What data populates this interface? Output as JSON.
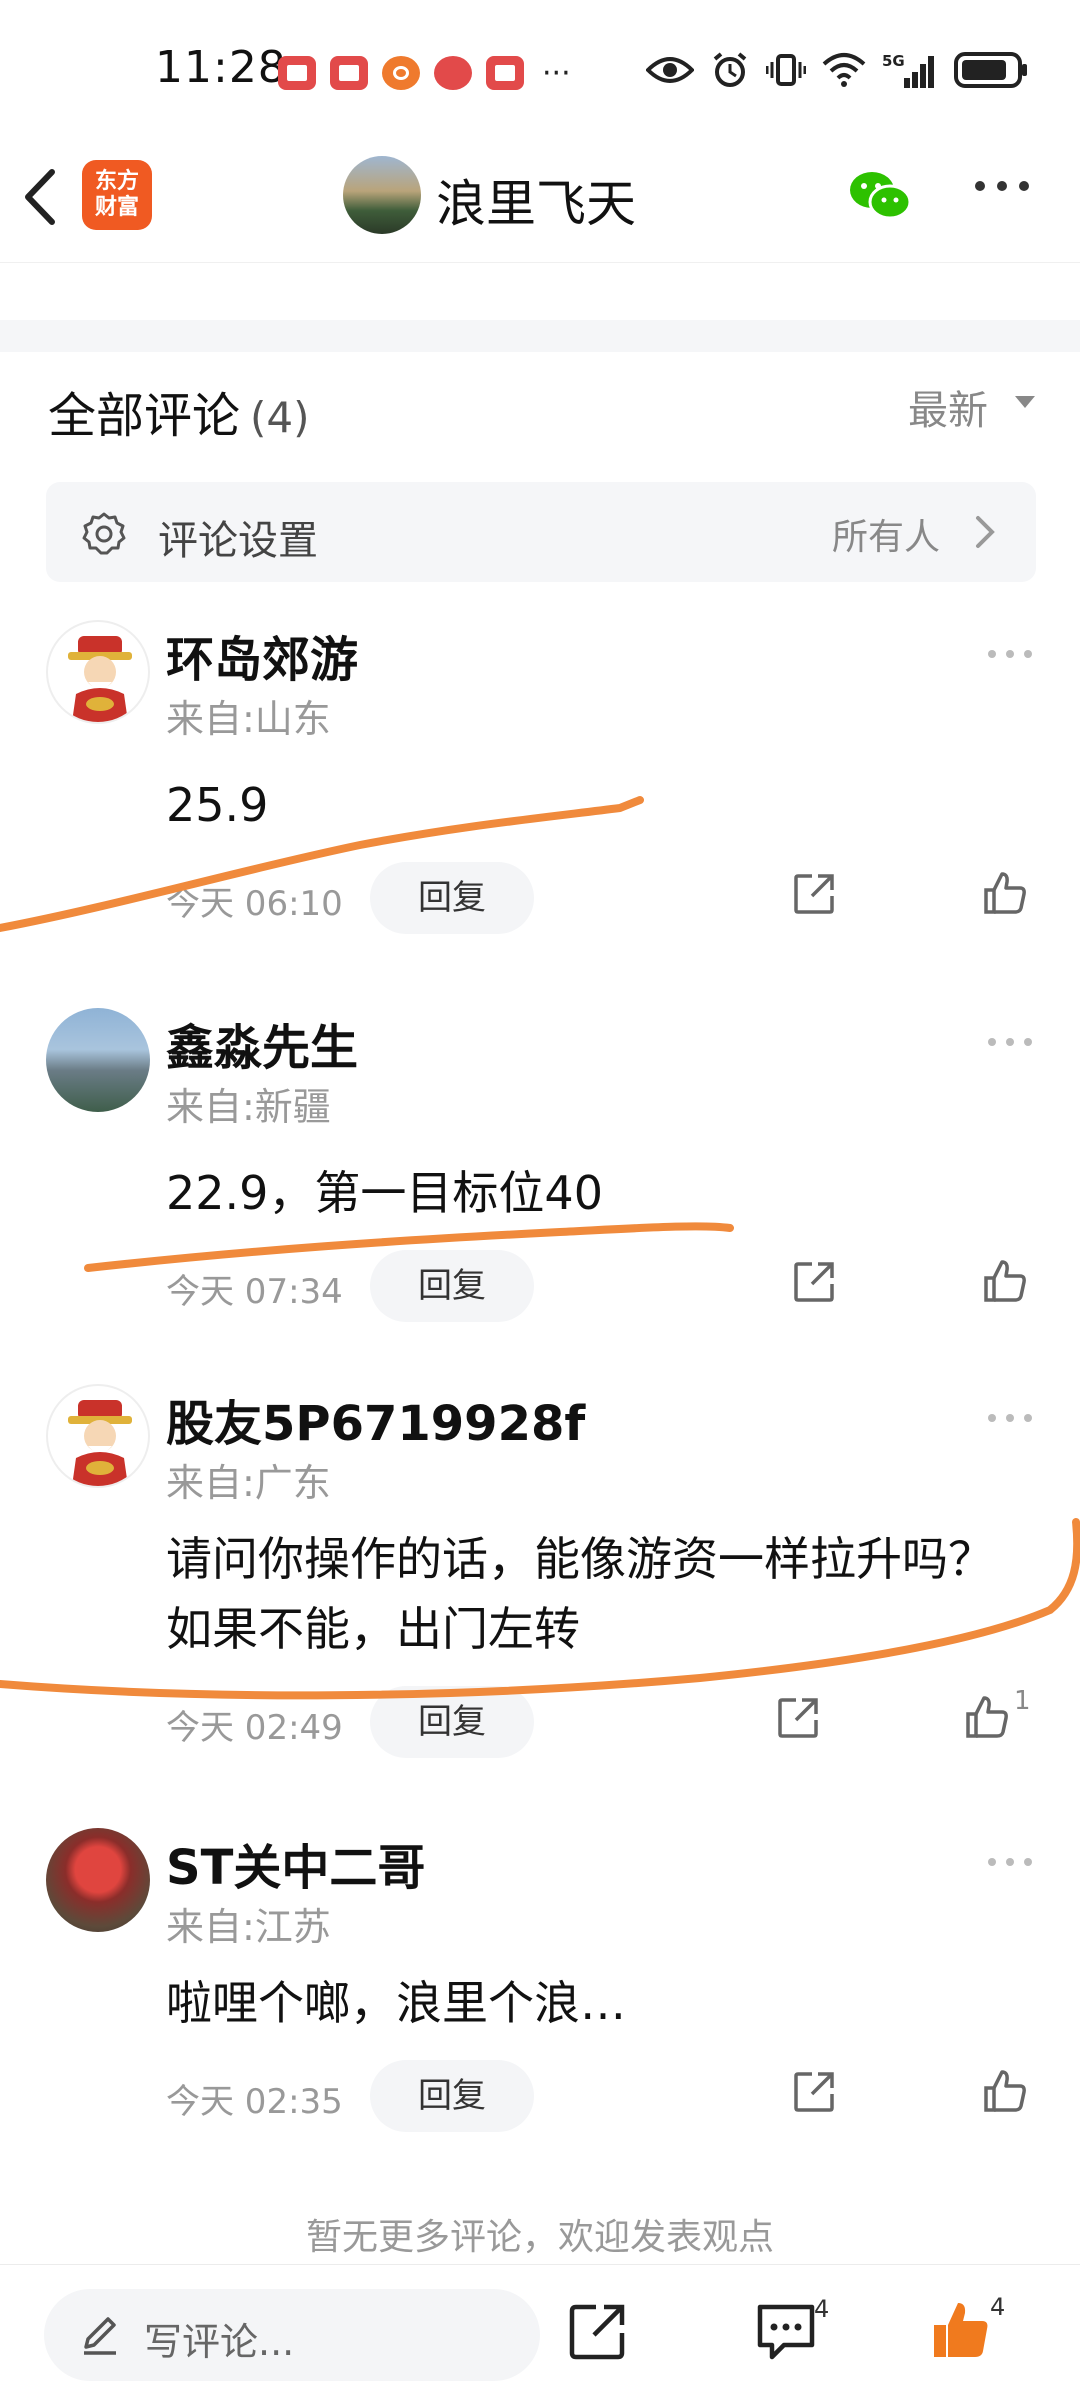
{
  "status_bar": {
    "time": "11:28",
    "more": "···",
    "notification_icons": [
      "book-icon",
      "book-icon",
      "video-icon",
      "record-icon",
      "book-icon"
    ],
    "system_icons": [
      "eye-icon",
      "alarm-icon",
      "vibrate-icon",
      "wifi-icon",
      "signal-5g-icon",
      "battery-icon"
    ]
  },
  "header": {
    "app_logo_line1": "东方",
    "app_logo_line2": "财富",
    "title": "浪里飞天"
  },
  "comments_section": {
    "title": "全部评论",
    "count": "(4)",
    "sort": "最新",
    "settings_label": "评论设置",
    "settings_value": "所有人"
  },
  "comments": [
    {
      "name": "环岛郊游",
      "location": "来自:山东",
      "text": "25.9",
      "time": "今天 06:10",
      "reply": "回复",
      "likes": ""
    },
    {
      "name": "鑫淼先生",
      "location": "来自:新疆",
      "text": "22.9，第一目标位40",
      "time": "今天 07:34",
      "reply": "回复",
      "likes": ""
    },
    {
      "name": "股友5P6719928f",
      "location": "来自:广东",
      "text": "请问你操作的话，能像游资一样拉升吗？如果不能，出门左转",
      "time": "今天 02:49",
      "reply": "回复",
      "likes": "1"
    },
    {
      "name": "ST关中二哥",
      "location": "来自:江苏",
      "text": "啦哩个啷，浪里个浪…",
      "time": "今天 02:35",
      "reply": "回复",
      "likes": ""
    }
  ],
  "no_more_text": "暂无更多评论，欢迎发表观点",
  "bottom_bar": {
    "write_placeholder": "写评论...",
    "comment_count": "4",
    "like_count": "4"
  },
  "colors": {
    "accent_orange": "#f07a1e",
    "marker_orange": "#f08a3c",
    "logo_red": "#f05a22",
    "wechat_green": "#2dc100"
  }
}
